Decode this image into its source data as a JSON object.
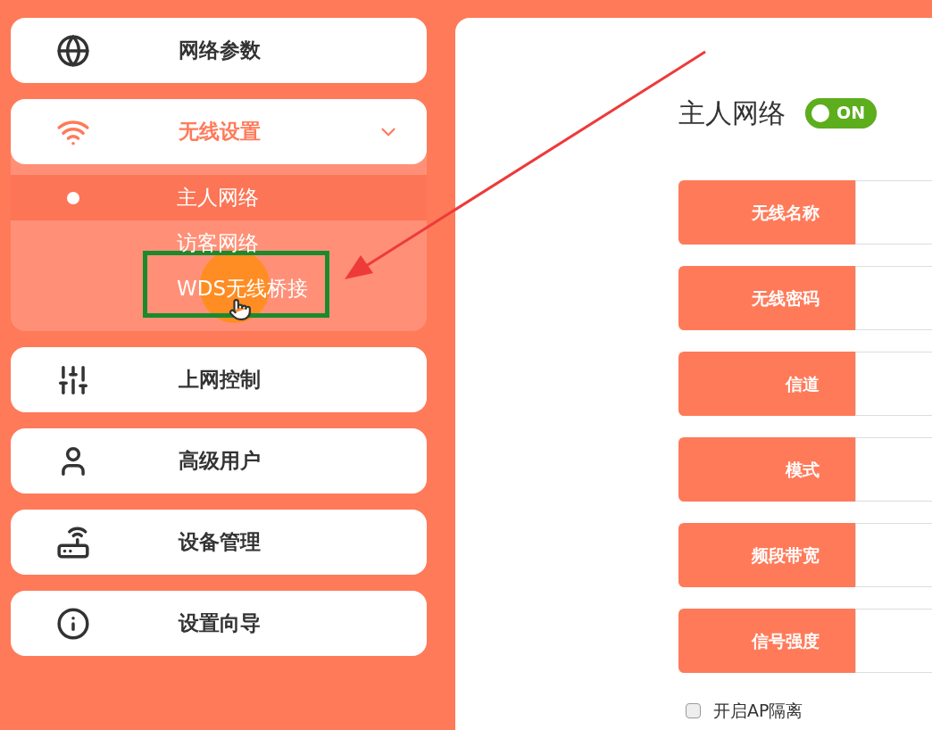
{
  "sidebar": {
    "items": [
      {
        "kind": "globe",
        "label": "网络参数",
        "expanded": false
      },
      {
        "kind": "wifi",
        "label": "无线设置",
        "expanded": true,
        "children": [
          {
            "label": "主人网络",
            "selected": true
          },
          {
            "label": "访客网络",
            "selected": false
          },
          {
            "label": "WDS无线桥接",
            "selected": false
          }
        ]
      },
      {
        "kind": "sliders",
        "label": "上网控制",
        "expanded": false
      },
      {
        "kind": "user",
        "label": "高级用户",
        "expanded": false
      },
      {
        "kind": "router",
        "label": "设备管理",
        "expanded": false
      },
      {
        "kind": "info",
        "label": "设置向导",
        "expanded": false
      }
    ]
  },
  "panel": {
    "title": "主人网络",
    "toggle": {
      "on": true,
      "label": "ON"
    },
    "fields": [
      {
        "label": "无线名称"
      },
      {
        "label": "无线密码"
      },
      {
        "label": "信道"
      },
      {
        "label": "模式"
      },
      {
        "label": "频段带宽"
      },
      {
        "label": "信号强度"
      }
    ],
    "checkbox": {
      "label": "开启AP隔离",
      "checked": false
    }
  }
}
